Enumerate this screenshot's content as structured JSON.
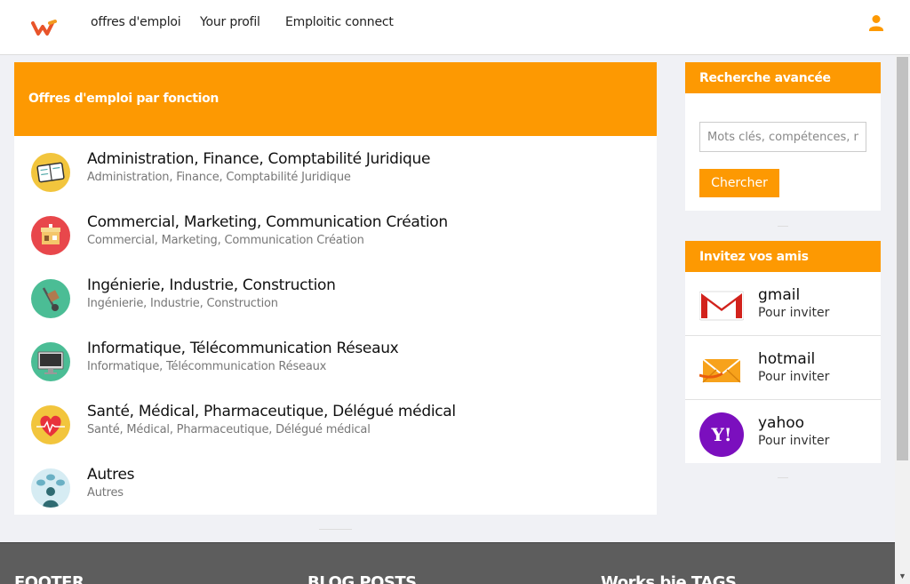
{
  "nav": {
    "items": [
      "offres d'emploi",
      "Your profil",
      "Emploitic connect"
    ]
  },
  "main": {
    "header": "Offres d'emploi par fonction",
    "categories": [
      {
        "title": "Administration, Finance, Comptabilité Juridique",
        "subtitle": "Administration, Finance, Comptabilité Juridique",
        "icon": "notebook-icon"
      },
      {
        "title": "Commercial, Marketing, Communication Création",
        "subtitle": "Commercial, Marketing, Communication Création",
        "icon": "shop-icon"
      },
      {
        "title": "Ingénierie, Industrie, Construction",
        "subtitle": "Ingénierie, Industrie, Construction",
        "icon": "hand-truck-icon"
      },
      {
        "title": "Informatique, Télécommunication Réseaux",
        "subtitle": "Informatique, Télécommunication Réseaux",
        "icon": "monitor-icon"
      },
      {
        "title": "Santé, Médical, Pharmaceutique, Délégué médical",
        "subtitle": "Santé, Médical, Pharmaceutique, Délégué médical",
        "icon": "heart-pulse-icon"
      },
      {
        "title": "Autres",
        "subtitle": "Autres",
        "icon": "speech-bubbles-icon"
      }
    ]
  },
  "search": {
    "header": "Recherche avancée",
    "placeholder": "Mots clés, compétences, m",
    "button": "Chercher"
  },
  "invite": {
    "header": "Invitez vos amis",
    "items": [
      {
        "name": "gmail",
        "action": "Pour inviter",
        "icon": "gmail-icon"
      },
      {
        "name": "hotmail",
        "action": "Pour inviter",
        "icon": "hotmail-icon"
      },
      {
        "name": "yahoo",
        "action": "Pour inviter",
        "icon": "yahoo-icon"
      }
    ]
  },
  "footer": {
    "columns": [
      "FOOTER",
      "BLOG POSTS",
      "Works bie TAGS"
    ]
  },
  "colors": {
    "accent": "#fd9902",
    "footer": "#5d5d5d"
  }
}
